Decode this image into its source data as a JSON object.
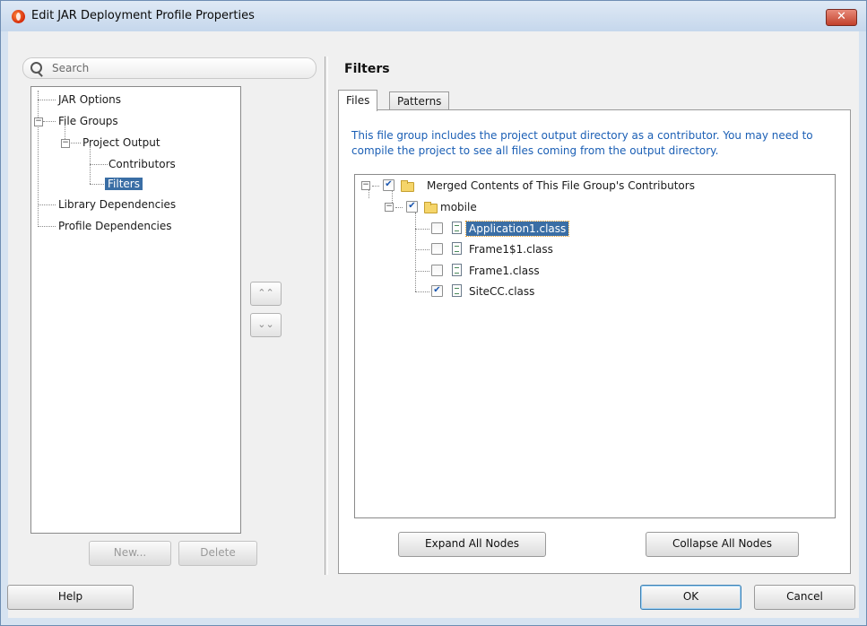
{
  "window": {
    "title": "Edit JAR Deployment Profile Properties",
    "close_glyph": "✕"
  },
  "search": {
    "placeholder": "Search"
  },
  "nav_tree": {
    "items": [
      {
        "label": "JAR Options"
      },
      {
        "label": "File Groups"
      },
      {
        "label": "Project Output"
      },
      {
        "label": "Contributors"
      },
      {
        "label": "Filters",
        "selected": true
      },
      {
        "label": "Library Dependencies"
      },
      {
        "label": "Profile Dependencies"
      }
    ]
  },
  "left_buttons": {
    "new": "New...",
    "delete": "Delete"
  },
  "reorder": {
    "up": "⌃⌃",
    "down": "⌄⌄"
  },
  "panel": {
    "title": "Filters",
    "tabs": [
      "Files",
      "Patterns"
    ],
    "active_tab": "Files",
    "info": "This file group includes the project output directory as a contributor.  You may need to compile the project to see all files coming from the output directory.",
    "tree": {
      "root": {
        "label": "Merged Contents of This File Group's Contributors",
        "checked": true
      },
      "folder": {
        "label": "mobile",
        "checked": true
      },
      "files": [
        {
          "label": "Application1.class",
          "checked": false,
          "selected": true
        },
        {
          "label": "Frame1$1.class",
          "checked": false
        },
        {
          "label": "Frame1.class",
          "checked": false
        },
        {
          "label": "SiteCC.class",
          "checked": true
        }
      ]
    },
    "expand_all": "Expand All Nodes",
    "collapse_all": "Collapse All Nodes"
  },
  "footer": {
    "help": "Help",
    "ok": "OK",
    "cancel": "Cancel"
  },
  "colors": {
    "selection": "#3a6ea5",
    "info_text": "#1b5fb5",
    "titlebar": "#c5d7ec"
  }
}
